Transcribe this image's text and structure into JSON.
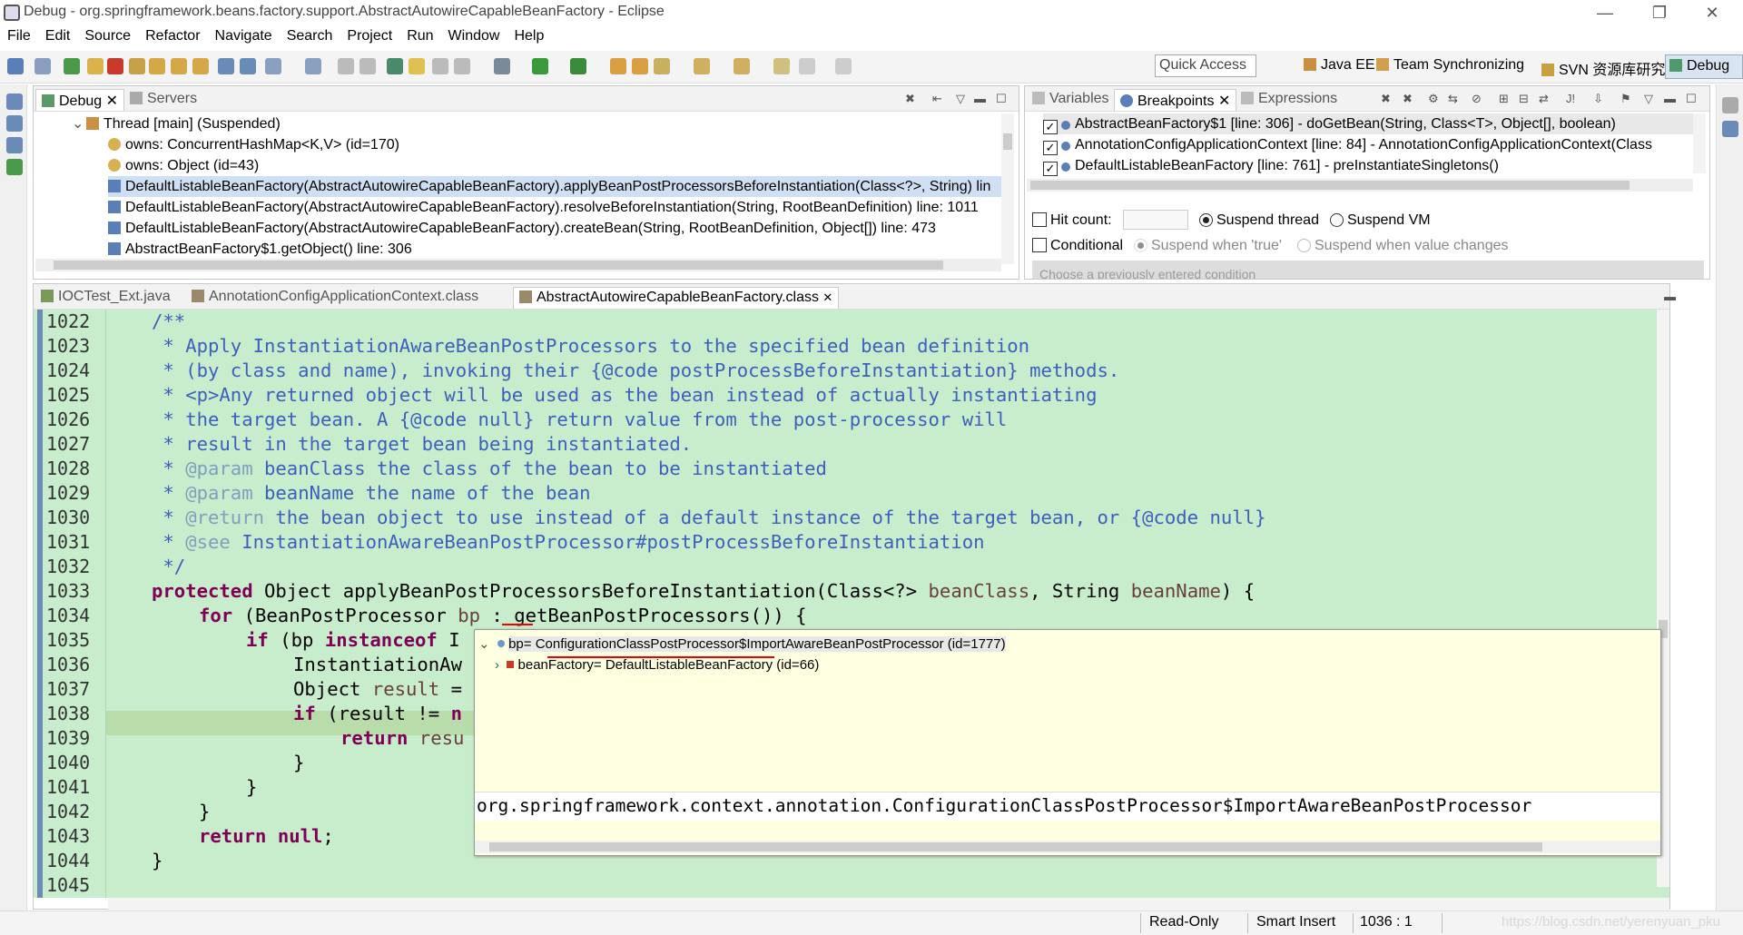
{
  "window": {
    "title": "Debug - org.springframework.beans.factory.support.AbstractAutowireCapableBeanFactory - Eclipse",
    "minimize": "—",
    "restore": "❐",
    "close": "✕"
  },
  "menu": [
    "File",
    "Edit",
    "Source",
    "Refactor",
    "Navigate",
    "Search",
    "Project",
    "Run",
    "Window",
    "Help"
  ],
  "toolbar": {
    "quick_access": "Quick Access",
    "perspectives": [
      "Java EE",
      "Team Synchronizing",
      "SVN 资源库研究",
      "Debug"
    ]
  },
  "debug_view": {
    "tabs": [
      "Debug",
      "Servers"
    ],
    "rows": [
      "Thread [main] (Suspended)",
      "owns: ConcurrentHashMap<K,V>  (id=170)",
      "owns: Object  (id=43)",
      "DefaultListableBeanFactory(AbstractAutowireCapableBeanFactory).applyBeanPostProcessorsBeforeInstantiation(Class<?>, String) lin",
      "DefaultListableBeanFactory(AbstractAutowireCapableBeanFactory).resolveBeforeInstantiation(String, RootBeanDefinition) line: 1011",
      "DefaultListableBeanFactory(AbstractAutowireCapableBeanFactory).createBean(String, RootBeanDefinition, Object[]) line: 473",
      "AbstractBeanFactory$1.getObject() line: 306"
    ]
  },
  "breakpoints_view": {
    "tabs": [
      "Variables",
      "Breakpoints",
      "Expressions"
    ],
    "rows": [
      "AbstractBeanFactory$1 [line: 306] - doGetBean(String, Class<T>, Object[], boolean)",
      "AnnotationConfigApplicationContext [line: 84] - AnnotationConfigApplicationContext(Class",
      "DefaultListableBeanFactory [line: 761] - preInstantiateSingletons()"
    ],
    "hit_count": "Hit count:",
    "suspend_thread": "Suspend thread",
    "suspend_vm": "Suspend VM",
    "conditional": "Conditional",
    "suspend_true": "Suspend when 'true'",
    "suspend_changes": "Suspend when value changes",
    "choose_condition": "Choose a previously entered condition"
  },
  "editor": {
    "tabs": [
      "IOCTest_Ext.java",
      "AnnotationConfigApplicationContext.class",
      "AbstractAutowireCapableBeanFactory.class"
    ],
    "line_numbers": [
      "1022",
      "1023",
      "1024",
      "1025",
      "1026",
      "1027",
      "1028",
      "1029",
      "1030",
      "1031",
      "1032",
      "1033",
      "1034",
      "1035",
      "1036",
      "1037",
      "1038",
      "1039",
      "1040",
      "1041",
      "1042",
      "1043",
      "1044",
      "1045"
    ],
    "code": {
      "l1022": "/**",
      "l1023": " * Apply InstantiationAwareBeanPostProcessors to the specified bean definition",
      "l1024": " * (by class and name), invoking their {@code postProcessBeforeInstantiation} methods.",
      "l1025": " * <p>Any returned object will be used as the bean instead of actually instantiating",
      "l1026": " * the target bean. A {@code null} return value from the post-processor will",
      "l1027": " * result in the target bean being instantiated.",
      "l1028a": " * ",
      "l1028b": "@param",
      "l1028c": " beanClass the class of the bean to be instantiated",
      "l1029a": " * ",
      "l1029b": "@param",
      "l1029c": " beanName the name of the bean",
      "l1030a": " * ",
      "l1030b": "@return",
      "l1030c": " the bean object to use instead of a default instance of the target bean, or {@code null}",
      "l1031a": " * ",
      "l1031b": "@see",
      "l1031c": " InstantiationAwareBeanPostProcessor#postProcessBeforeInstantiation",
      "l1032": " */",
      "l1033_kw": "protected",
      "l1033_a": " Object applyBeanPostProcessorsBeforeInstantiation(Class<?> ",
      "l1033_p1": "beanClass",
      "l1033_b": ", String ",
      "l1033_p2": "beanName",
      "l1033_c": ") {",
      "l1034_kw": "for",
      "l1034_a": " (BeanPostProcessor ",
      "l1034_v": "bp",
      "l1034_b": " : getBeanPostProcessors()) {",
      "l1035_kw": "if",
      "l1035_a": " (bp ",
      "l1035_kw2": "instanceof",
      "l1035_b": " I",
      "l1036": "InstantiationAw",
      "l1037_a": "Object ",
      "l1037_v": "result",
      "l1037_b": " =",
      "l1038_kw": "if",
      "l1038_a": " (result != ",
      "l1038_kw2": "n",
      "l1039_kw": "return",
      "l1039_a": " resu",
      "l1040": "}",
      "l1041": "}",
      "l1042": "}",
      "l1043_kw": "return",
      "l1043_kw2": "null",
      "l1043_a": ";",
      "l1044": "}"
    }
  },
  "hover": {
    "var_row": "bp= ConfigurationClassPostProcessor$ImportAwareBeanPostProcessor  (id=1777)",
    "child_row": "beanFactory= DefaultListableBeanFactory  (id=66)",
    "detail": "org.springframework.context.annotation.ConfigurationClassPostProcessor$ImportAwareBeanPostProcessor"
  },
  "status": {
    "read_only": "Read-Only",
    "insert_mode": "Smart Insert",
    "position": "1036 : 1",
    "watermark": "https://blog.csdn.net/yerenyuan_pku"
  }
}
